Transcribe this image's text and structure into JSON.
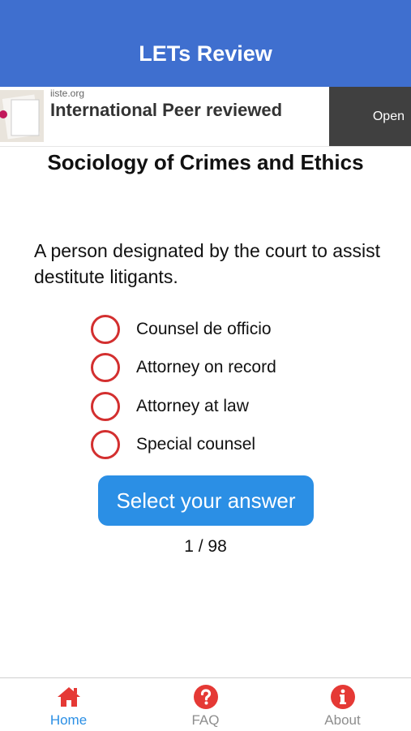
{
  "header": {
    "title": "LETs Review"
  },
  "ad": {
    "domain": "iiste.org",
    "headline": "International Peer reviewed",
    "cta_label": "Open"
  },
  "quiz": {
    "subject": "Sociology of Crimes and Ethics",
    "question": "A person designated by the court to assist destitute litigants.",
    "options": [
      {
        "label": "Counsel de officio"
      },
      {
        "label": "Attorney on record"
      },
      {
        "label": "Attorney at law"
      },
      {
        "label": "Special counsel"
      }
    ],
    "answer_button_label": "Select your answer",
    "progress": "1 / 98"
  },
  "tabbar": {
    "items": [
      {
        "label": "Home",
        "icon": "home-icon",
        "active": true
      },
      {
        "label": "FAQ",
        "icon": "question-circle-icon",
        "active": false
      },
      {
        "label": "About",
        "icon": "info-circle-icon",
        "active": false
      }
    ]
  },
  "colors": {
    "header_bg": "#3f6fcf",
    "accent": "#2b8fe5",
    "radio_border": "#d32f2f",
    "tab_icon": "#e53935",
    "ad_cta_bg": "#404040"
  }
}
